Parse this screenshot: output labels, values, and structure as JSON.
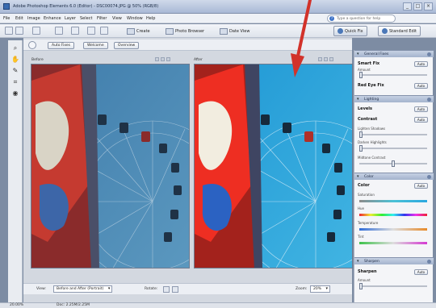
{
  "window": {
    "title": "Adobe Photoshop Elements 6.0 (Editor) - DSC00074.JPG @ 50% (RGB/8)",
    "controls": [
      "_",
      "□",
      "×"
    ]
  },
  "menu": [
    "File",
    "Edit",
    "Image",
    "Enhance",
    "Layer",
    "Select",
    "Filter",
    "View",
    "Window",
    "Help"
  ],
  "help_search": {
    "icon": "question-icon",
    "placeholder": "Type a question for help"
  },
  "toolbar": {
    "create": "Create",
    "organizer": "Photo Browser",
    "date_view": "Date View",
    "quick_fix": "Quick Fix",
    "standard_edit": "Standard Edit"
  },
  "subbar": {
    "buttons": [
      "Auto Fixes",
      "Welcome",
      "Overview"
    ]
  },
  "panes": {
    "before_label": "Before",
    "after_label": "After"
  },
  "bottom": {
    "view_label": "View:",
    "view_value": "Before and After (Portrait)",
    "rotate_label": "Rotate:",
    "zoom_label": "Zoom:",
    "zoom_value": "20%"
  },
  "palette": {
    "general_fixes": {
      "title": "General Fixes",
      "smart_fix": "Smart Fix",
      "smart_fix_auto": "Auto",
      "amount": "Amount",
      "red_eye": "Red Eye Fix",
      "red_eye_auto": "Auto"
    },
    "lighting": {
      "title": "Lighting",
      "levels": "Levels",
      "levels_auto": "Auto",
      "contrast": "Contrast",
      "contrast_auto": "Auto",
      "lighten_shadows": "Lighten Shadows",
      "darken_highlights": "Darken Highlights",
      "midtone_contrast": "Midtone Contrast"
    },
    "color": {
      "title": "Color",
      "color_label": "Color",
      "color_auto": "Auto",
      "saturation": "Saturation",
      "hue": "Hue",
      "temperature": "Temperature",
      "tint": "Tint"
    },
    "sharpen": {
      "title": "Sharpen",
      "sharpen_label": "Sharpen",
      "sharpen_auto": "Auto",
      "amount": "Amount"
    }
  },
  "status": {
    "zoom": "20.00%",
    "doc": "Doc: 2.25M/2.25M"
  },
  "colors": {
    "accent": "#4b78b8",
    "arrow": "#d2322a",
    "sky_before": "#4f90b8",
    "sky_after": "#2fa6dc"
  }
}
